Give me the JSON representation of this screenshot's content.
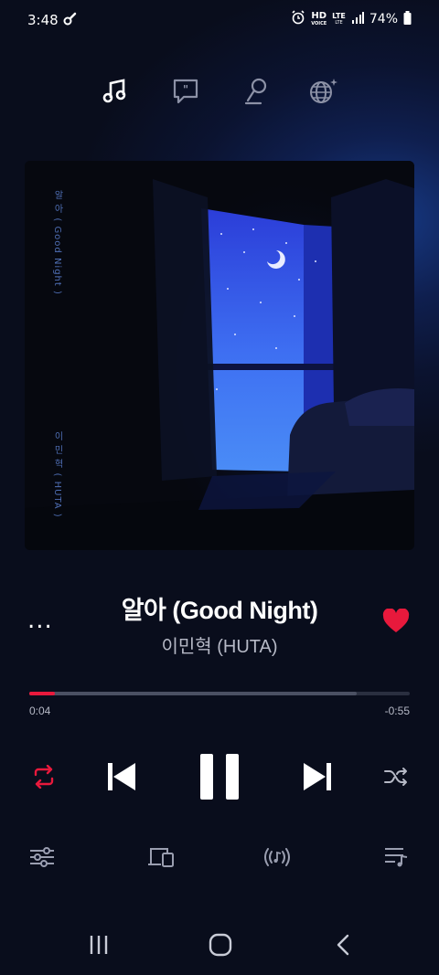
{
  "status_bar": {
    "time": "3:48",
    "hd": "HD",
    "voice": "VOICE",
    "lte": "LTE",
    "lte_sub": "LTE",
    "battery": "74%"
  },
  "tabs": [
    {
      "name": "music-note-icon",
      "active": true
    },
    {
      "name": "lyrics-icon",
      "active": false
    },
    {
      "name": "microphone-icon",
      "active": false
    },
    {
      "name": "globe-icon",
      "active": false
    }
  ],
  "album_art": {
    "vertical_title": "알 아 ( Good Night )",
    "vertical_artist": "이 민 혁 ( HUTA )"
  },
  "track": {
    "title": "알아 (Good Night)",
    "artist": "이민혁 (HUTA)",
    "more_label": "...",
    "liked": true
  },
  "playback": {
    "elapsed": "0:04",
    "remaining": "-0:55",
    "progress": 0.068,
    "buffered": 0.86
  },
  "colors": {
    "accent": "#e8193c",
    "background": "#0b1330"
  },
  "controls": {
    "repeat": "repeat-icon",
    "previous": "skip-previous-icon",
    "play_pause": "pause-icon",
    "next": "skip-next-icon",
    "shuffle": "shuffle-icon"
  },
  "bottom_actions": [
    "equalizer-icon",
    "devices-icon",
    "radio-icon",
    "queue-icon"
  ],
  "nav": [
    "recents-icon",
    "home-icon",
    "back-icon"
  ]
}
